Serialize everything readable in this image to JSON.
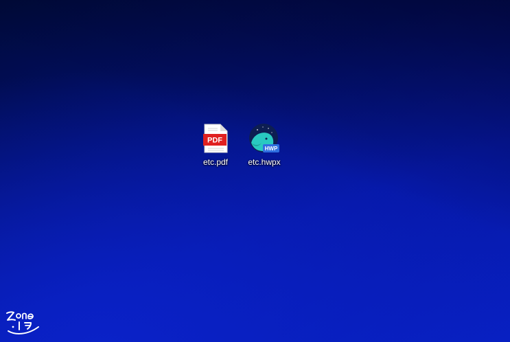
{
  "desktop": {
    "icons": [
      {
        "label": "etc.pdf",
        "icon": "pdf-file-icon",
        "badge": "PDF"
      },
      {
        "label": "etc.hwpx",
        "icon": "hancom-whale-hwp-icon",
        "badge": "HWP"
      }
    ]
  },
  "watermark": {
    "text": "zone ㅣㅋ",
    "icon": "handwritten-signature-logo"
  },
  "colors": {
    "pdf_red": "#e02020",
    "hwp_teal": "#29c9c0",
    "hwp_blue": "#2f6fe0",
    "hwp_navy": "#0d1e52"
  }
}
